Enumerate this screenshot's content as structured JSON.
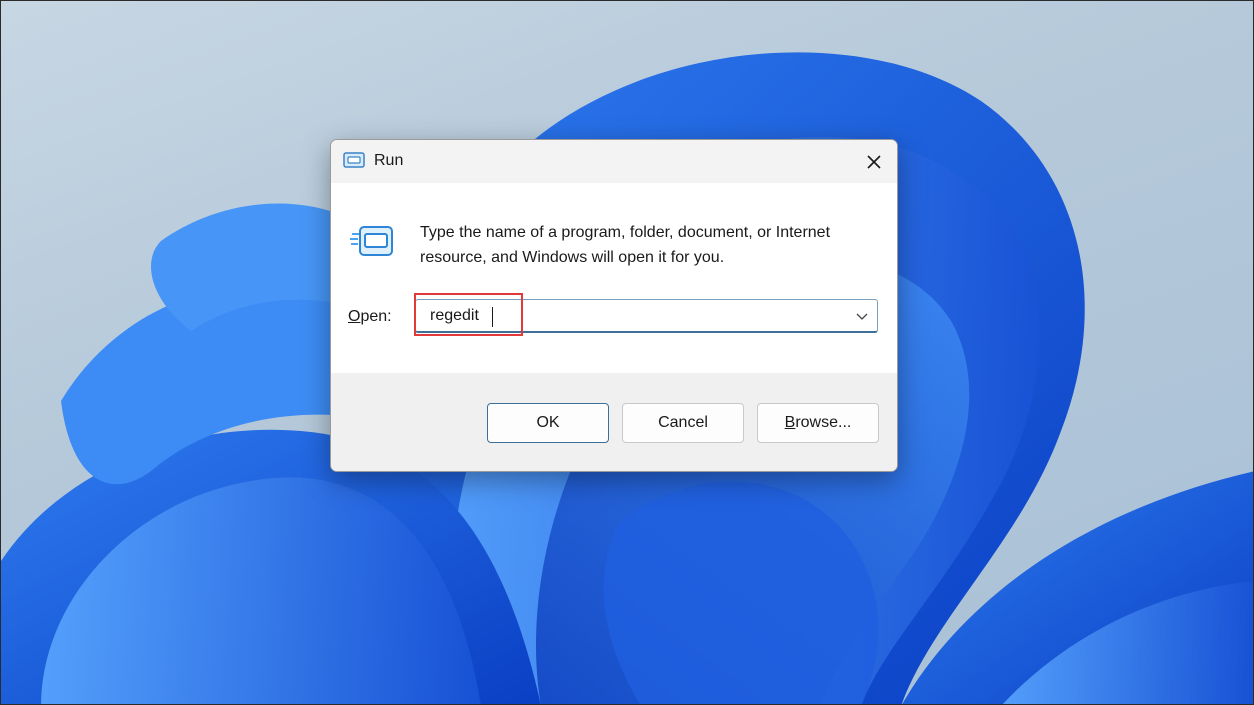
{
  "dialog": {
    "title": "Run",
    "title_icon": "run-icon",
    "close_icon": "close-icon",
    "description": "Type the name of a program, folder, document, or Internet resource, and Windows will open it for you.",
    "open_label_mnemonic": "O",
    "open_label_rest": "pen:",
    "open_value": "regedit",
    "dropdown_icon": "chevron-down-icon",
    "buttons": {
      "ok": "OK",
      "cancel": "Cancel",
      "browse_mnemonic": "B",
      "browse_rest": "rowse..."
    }
  },
  "annotation": {
    "highlight_color": "#e2393a"
  },
  "colors": {
    "accent": "#3d6f99",
    "wallpaper_blue": "#1f5fe0"
  }
}
